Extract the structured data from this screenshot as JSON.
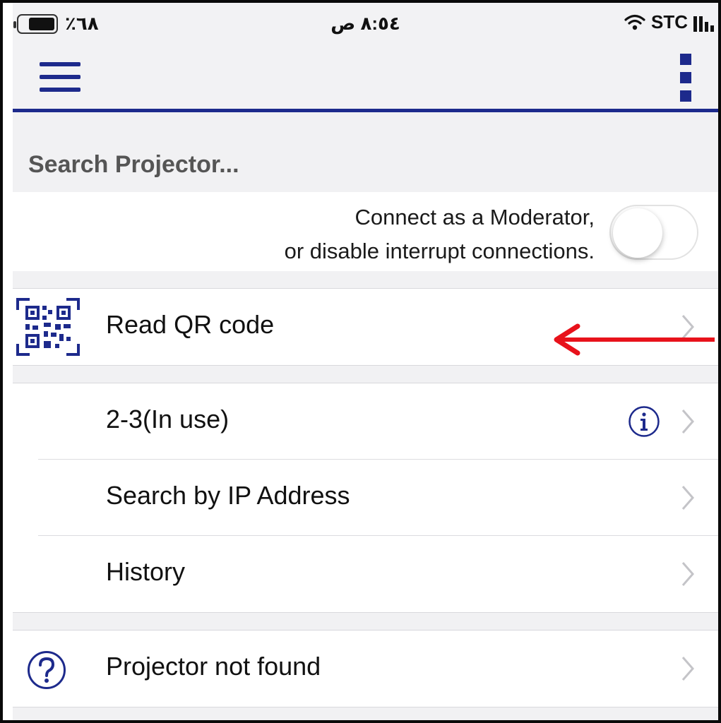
{
  "status_bar": {
    "battery": "٪٦٨",
    "time": "٨:٥٤ ص",
    "carrier": "STC"
  },
  "nav": {
    "menu_icon": "hamburger-icon",
    "more_icon": "kebab-icon",
    "accent_color": "#1d2a8c"
  },
  "search_header": "Search Projector...",
  "moderator": {
    "line1": "Connect as a Moderator,",
    "line2": "or disable interrupt connections.",
    "toggle_on": false
  },
  "qr_row": {
    "label": "Read QR code",
    "icon": "qr-code-icon"
  },
  "projector_rows": [
    {
      "label": "2-3(In use)",
      "has_info": true
    },
    {
      "label": "Search by IP Address"
    },
    {
      "label": "History"
    }
  ],
  "help_row": {
    "label": "Projector not found",
    "icon": "question-circle-icon"
  },
  "annotation": {
    "color": "#e8121b"
  }
}
